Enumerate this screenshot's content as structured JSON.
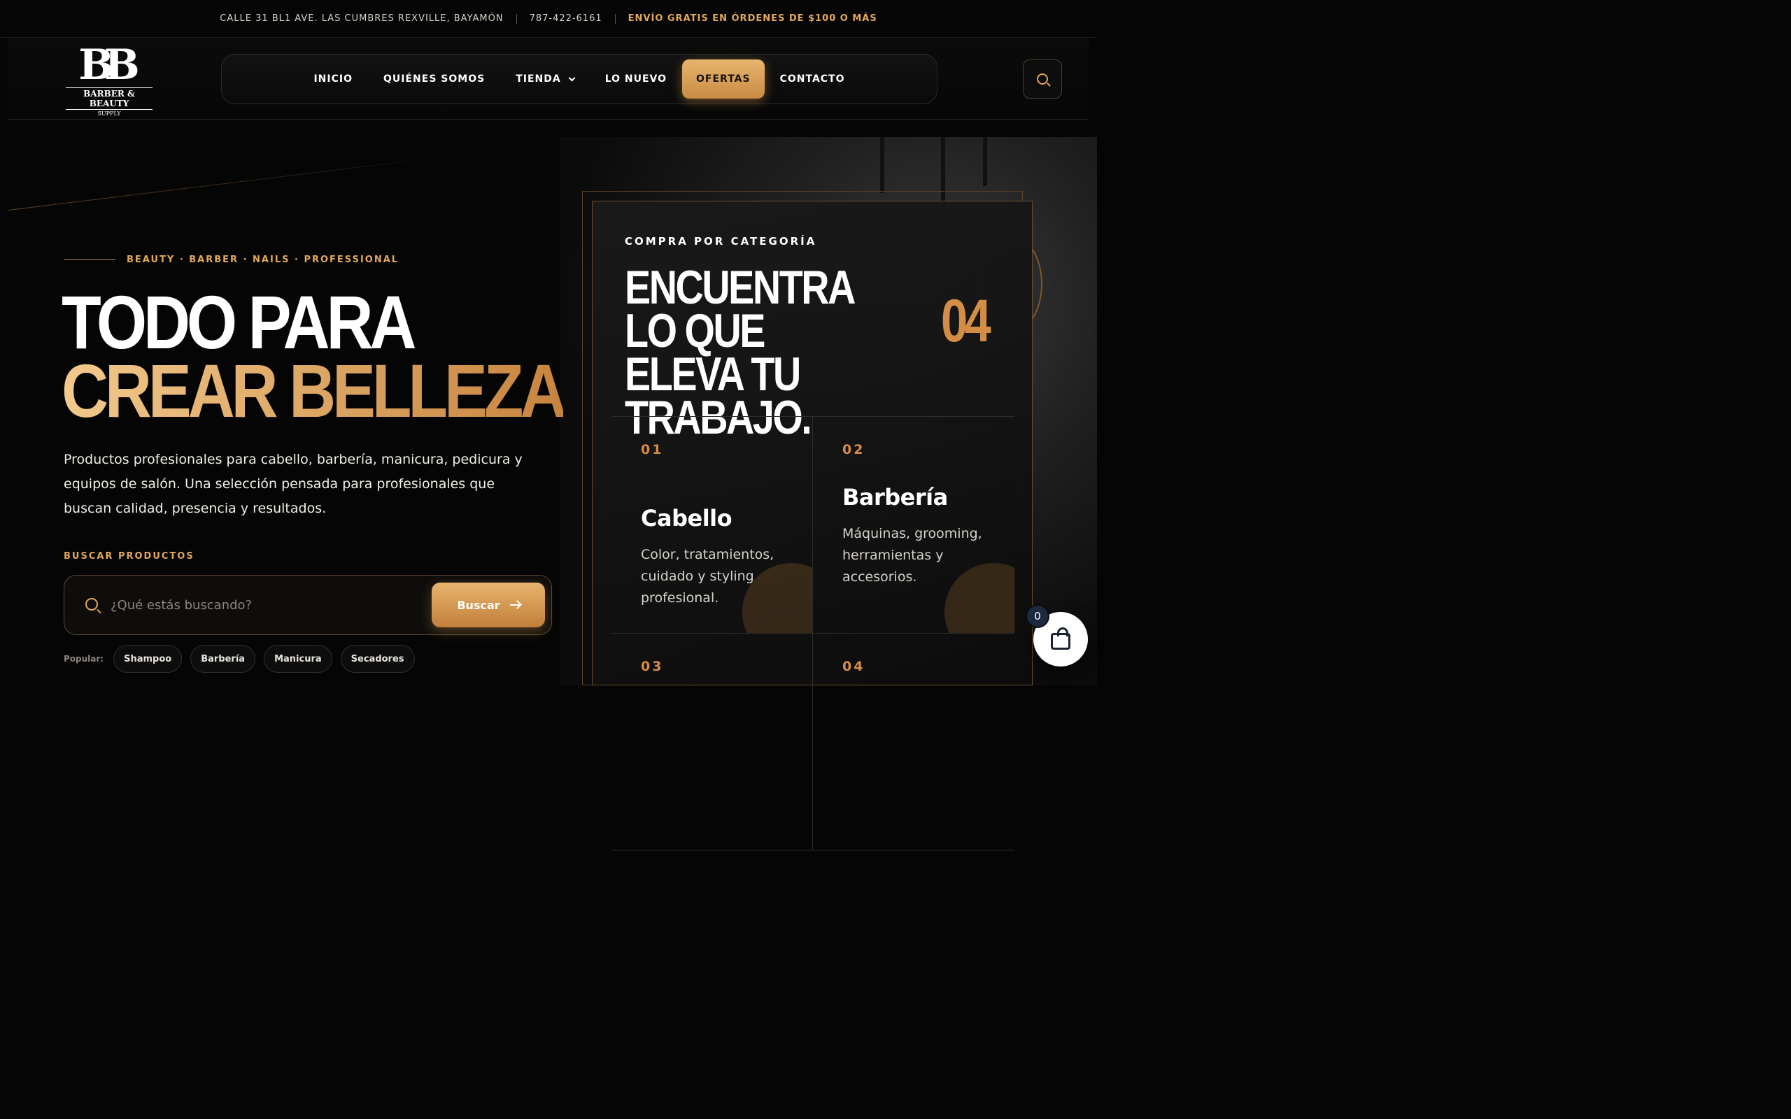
{
  "topbar": {
    "address": "CALLE 31 BL1 AVE. LAS CUMBRES REXVILLE, BAYAMÓN",
    "phone": "787-422-6161",
    "promo": "ENVÍO GRATIS EN ÓRDENES DE $100 O MÁS"
  },
  "logo": {
    "monogram": "BB",
    "name": "BARBER & BEAUTY",
    "sub": "SUPPLY"
  },
  "nav": {
    "items": [
      {
        "label": "INICIO"
      },
      {
        "label": "QUIÉNES SOMOS"
      },
      {
        "label": "TIENDA"
      },
      {
        "label": "LO NUEVO"
      },
      {
        "label": "OFERTAS"
      },
      {
        "label": "CONTACTO"
      }
    ],
    "active": "OFERTAS"
  },
  "hero": {
    "eyebrow": "BEAUTY · BARBER · NAILS · PROFESSIONAL",
    "title_line1": "TODO PARA",
    "title_line2": "CREAR BELLEZA",
    "lead": "Productos profesionales para cabello, barbería, manicura, pedicura y equipos de salón. Una selección pensada para profesionales que buscan calidad, presencia y resultados.",
    "search_label": "BUSCAR PRODUCTOS",
    "search_placeholder": "¿Qué estás buscando?",
    "search_value": "",
    "search_button": "Buscar",
    "popular_label": "Popular:",
    "popular": [
      "Shampoo",
      "Barbería",
      "Manicura",
      "Secadores"
    ]
  },
  "card": {
    "kicker": "COMPRA POR CATEGORÍA",
    "title": "ENCUENTRA LO QUE ELEVA TU TRABAJO.",
    "count": "04",
    "categories": [
      {
        "num": "01",
        "name": "Cabello",
        "desc": "Color, tratamientos, cuidado y styling profesional."
      },
      {
        "num": "02",
        "name": "Barbería",
        "desc": "Máquinas, grooming, herramientas y accesorios."
      },
      {
        "num": "03",
        "name": "",
        "desc": ""
      },
      {
        "num": "04",
        "name": "",
        "desc": ""
      }
    ]
  },
  "cart": {
    "count": "0"
  },
  "colors": {
    "accent": "#e3a859",
    "accent_dark": "#c27f3b",
    "background": "#050505"
  }
}
